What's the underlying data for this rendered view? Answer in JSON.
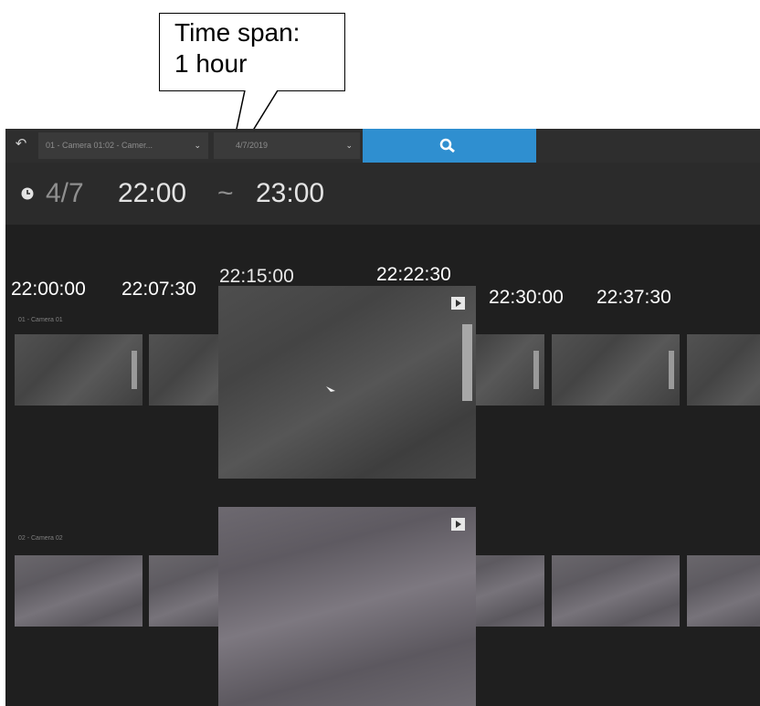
{
  "callout": {
    "line1": "Time span:",
    "line2": "1 hour"
  },
  "toolbar": {
    "camera_select": "01 - Camera 01:02 - Camer...",
    "date_select": "4/7/2019",
    "colors": {
      "search_button": "#2f8fd0"
    }
  },
  "time_range": {
    "date": "4/7",
    "start": "22:00",
    "separator": "~",
    "end": "23:00"
  },
  "timestamps": [
    "22:00:00",
    "22:07:30",
    "22:15:00",
    "22:22:30",
    "22:30:00",
    "22:37:30"
  ],
  "rows": [
    {
      "label": "01 - Camera 01"
    },
    {
      "label": "02 - Camera 02"
    }
  ]
}
